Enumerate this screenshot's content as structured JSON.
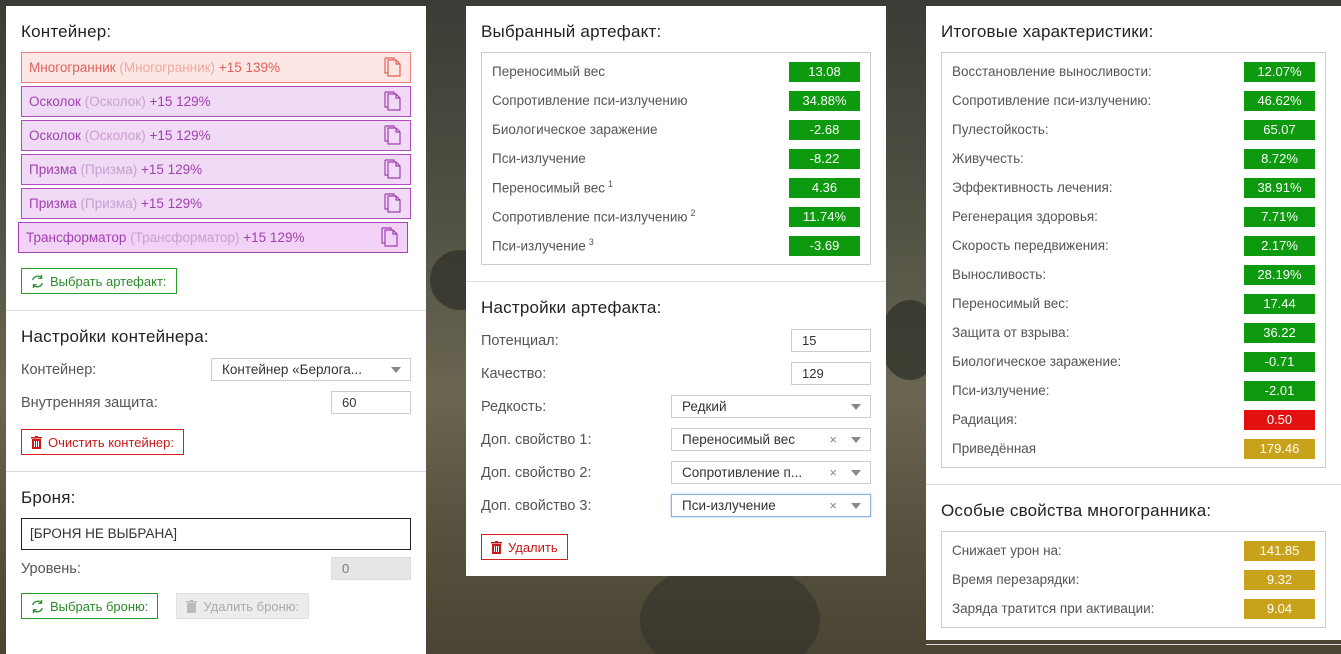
{
  "container_panel": {
    "title": "Контейнер:",
    "items": [
      {
        "name": "Многогранник",
        "sub": "(Многогранник)",
        "level": "+15 139%"
      },
      {
        "name": "Осколок",
        "sub": "(Осколок)",
        "level": "+15 129%"
      },
      {
        "name": "Осколок",
        "sub": "(Осколок)",
        "level": "+15 129%"
      },
      {
        "name": "Призма",
        "sub": "(Призма)",
        "level": "+15 129%"
      },
      {
        "name": "Призма",
        "sub": "(Призма)",
        "level": "+15 129%"
      },
      {
        "name": "Трансформатор",
        "sub": "(Трансформатор)",
        "level": "+15 129%"
      }
    ],
    "select_artifact_btn": "Выбрать артефакт:"
  },
  "container_settings": {
    "title": "Настройки контейнера:",
    "container_label": "Контейнер:",
    "container_value": "Контейнер «Берлога...",
    "inner_protection_label": "Внутренняя защита:",
    "inner_protection_value": "60",
    "clear_btn": "Очистить контейнер:"
  },
  "armor": {
    "title": "Броня:",
    "field_value": "[БРОНЯ НЕ ВЫБРАНА]",
    "level_label": "Уровень:",
    "level_value": "0",
    "select_btn": "Выбрать броню:",
    "delete_btn": "Удалить броню:"
  },
  "selected_artifact": {
    "title": "Выбранный артефакт:",
    "stats": [
      {
        "label": "Переносимый вес",
        "sup": "",
        "value": "13.08"
      },
      {
        "label": "Сопротивление пси-излучению",
        "sup": "",
        "value": "34.88%"
      },
      {
        "label": "Биологическое заражение",
        "sup": "",
        "value": "-2.68"
      },
      {
        "label": "Пси-излучение",
        "sup": "",
        "value": "-8.22"
      },
      {
        "label": "Переносимый вес",
        "sup": "1",
        "value": "4.36"
      },
      {
        "label": "Сопротивление пси-излучению",
        "sup": "2",
        "value": "11.74%"
      },
      {
        "label": "Пси-излучение",
        "sup": "3",
        "value": "-3.69"
      }
    ]
  },
  "artifact_settings": {
    "title": "Настройки артефакта:",
    "potential_label": "Потенциал:",
    "potential_value": "15",
    "quality_label": "Качество:",
    "quality_value": "129",
    "rarity_label": "Редкость:",
    "rarity_value": "Редкий",
    "prop1_label": "Доп. свойство 1:",
    "prop1_value": "Переносимый вес",
    "prop2_label": "Доп. свойство 2:",
    "prop2_value": "Сопротивление п...",
    "prop3_label": "Доп. свойство 3:",
    "prop3_value": "Пси-излучение",
    "delete_btn": "Удалить",
    "clear_glyph": "×"
  },
  "totals": {
    "title": "Итоговые характеристики:",
    "stats": [
      {
        "label": "Восстановление выносливости:",
        "value": "12.07%",
        "color": "green"
      },
      {
        "label": "Сопротивление пси-излучению:",
        "value": "46.62%",
        "color": "green"
      },
      {
        "label": "Пулестойкость:",
        "value": "65.07",
        "color": "green"
      },
      {
        "label": "Живучесть:",
        "value": "8.72%",
        "color": "green"
      },
      {
        "label": "Эффективность лечения:",
        "value": "38.91%",
        "color": "green"
      },
      {
        "label": "Регенерация здоровья:",
        "value": "7.71%",
        "color": "green"
      },
      {
        "label": "Скорость передвижения:",
        "value": "2.17%",
        "color": "green"
      },
      {
        "label": "Выносливость:",
        "value": "28.19%",
        "color": "green"
      },
      {
        "label": "Переносимый вес:",
        "value": "17.44",
        "color": "green"
      },
      {
        "label": "Защита от взрыва:",
        "value": "36.22",
        "color": "green"
      },
      {
        "label": "Биологическое заражение:",
        "value": "-0.71",
        "color": "green"
      },
      {
        "label": "Пси-излучение:",
        "value": "-2.01",
        "color": "green"
      },
      {
        "label": "Радиация:",
        "value": "0.50",
        "color": "red"
      },
      {
        "label": "Приведённая",
        "value": "179.46",
        "color": "gold"
      }
    ]
  },
  "special": {
    "title": "Особые свойства многогранника:",
    "stats": [
      {
        "label": "Снижает урон на:",
        "value": "141.85"
      },
      {
        "label": "Время перезарядки:",
        "value": "9.32"
      },
      {
        "label": "Заряда тратится при активации:",
        "value": "9.04"
      }
    ]
  },
  "colors": {
    "green": "#0e9a0e",
    "red": "#e21010",
    "gold": "#c8a21a",
    "artifact_purple": "#a040b0",
    "artifact_red": "#e0605a"
  },
  "icons": {
    "artifact_item": "document-icon",
    "select": "refresh-icon",
    "delete": "trash-icon"
  }
}
